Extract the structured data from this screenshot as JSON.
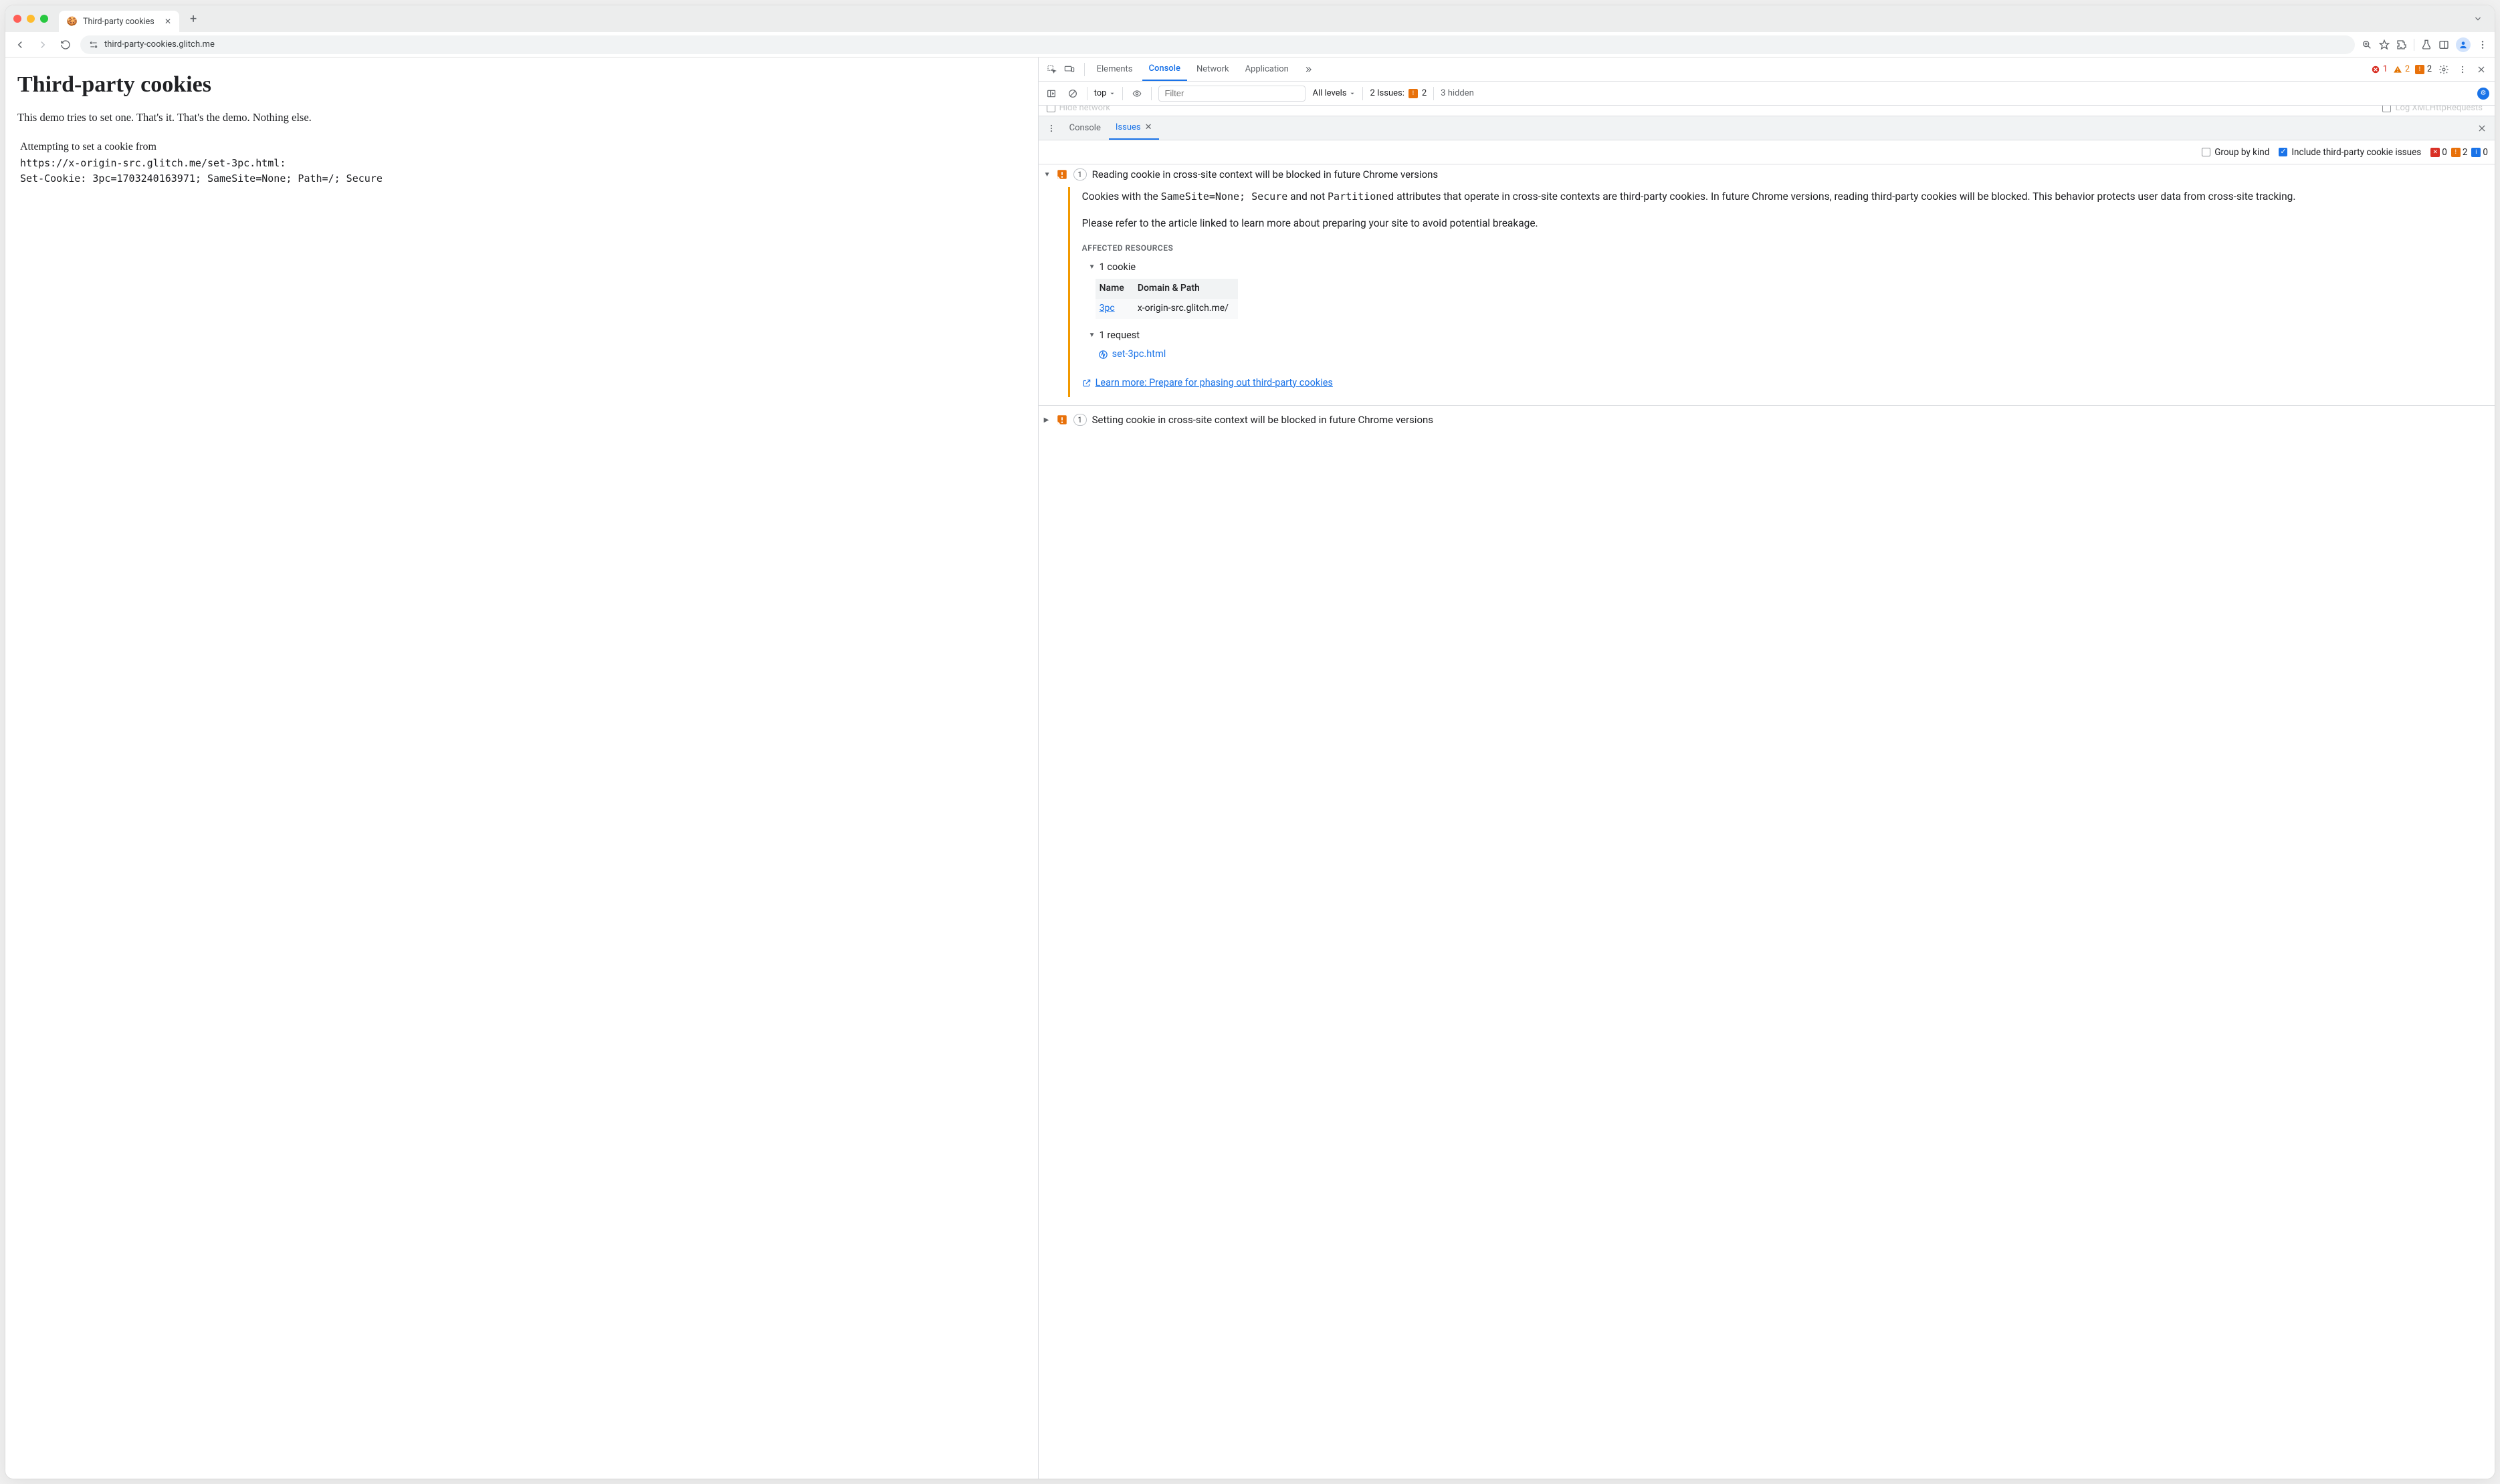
{
  "browser": {
    "tab_title": "Third-party cookies",
    "url": "third-party-cookies.glitch.me"
  },
  "page": {
    "heading": "Third-party cookies",
    "intro": "This demo tries to set one. That's it. That's the demo. Nothing else.",
    "attempt_line": "Attempting to set a cookie from",
    "attempt_url": "https://x-origin-src.glitch.me/set-3pc.html:",
    "set_cookie": "Set-Cookie: 3pc=1703240163971; SameSite=None; Path=/; Secure"
  },
  "devtools": {
    "tabs": {
      "elements": "Elements",
      "console": "Console",
      "network": "Network",
      "application": "Application"
    },
    "counts": {
      "errors": "1",
      "warnings": "2",
      "breaking": "2"
    },
    "console_bar": {
      "context": "top",
      "filter_placeholder": "Filter",
      "levels": "All levels",
      "issues_label": "2 Issues:",
      "issues_count": "2",
      "hidden": "3 hidden"
    },
    "hidden_row": {
      "left": "Hide network",
      "right": "Log XMLHttpRequests"
    },
    "drawer": {
      "console": "Console",
      "issues": "Issues"
    },
    "issues_toolbar": {
      "group_by_kind": "Group by kind",
      "include_3p": "Include third-party cookie issues",
      "errors": "0",
      "breaking": "2",
      "info": "0"
    },
    "issues": [
      {
        "expanded": true,
        "count": "1",
        "title": "Reading cookie in cross-site context will be blocked in future Chrome versions",
        "body_p1_pre": "Cookies with the ",
        "body_p1_code1": "SameSite=None; Secure",
        "body_p1_mid": " and not ",
        "body_p1_code2": "Partitioned",
        "body_p1_post": " attributes that operate in cross-site contexts are third-party cookies. In future Chrome versions, reading third-party cookies will be blocked. This behavior protects user data from cross-site tracking.",
        "body_p2": "Please refer to the article linked to learn more about preparing your site to avoid potential breakage.",
        "affected_heading": "AFFECTED RESOURCES",
        "cookies_label": "1 cookie",
        "table": {
          "col_name": "Name",
          "col_domain": "Domain & Path",
          "name_val": "3pc",
          "domain_val": "x-origin-src.glitch.me/"
        },
        "requests_label": "1 request",
        "request_link": "set-3pc.html",
        "learn_more": "Learn more: Prepare for phasing out third-party cookies"
      },
      {
        "expanded": false,
        "count": "1",
        "title": "Setting cookie in cross-site context will be blocked in future Chrome versions"
      }
    ]
  }
}
